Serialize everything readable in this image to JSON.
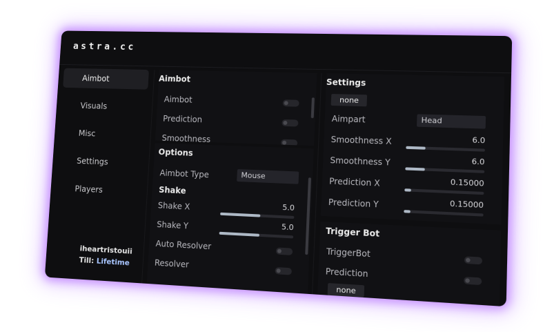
{
  "app": {
    "title": "astra.cc"
  },
  "sidebar": {
    "items": [
      {
        "label": "Aimbot"
      },
      {
        "label": "Visuals"
      },
      {
        "label": "Misc"
      },
      {
        "label": "Settings"
      },
      {
        "label": "Players"
      }
    ],
    "active_index": 0
  },
  "user": {
    "name": "iheartristouii",
    "till_label": "Till:",
    "till_value": "Lifetime"
  },
  "aimbot_panel": {
    "title": "Aimbot",
    "rows": [
      {
        "label": "Aimbot"
      },
      {
        "label": "Prediction"
      },
      {
        "label": "Smoothness"
      }
    ]
  },
  "options_panel": {
    "title": "Options",
    "aimbot_type": {
      "label": "Aimbot Type",
      "value": "Mouse"
    },
    "shake_heading": "Shake",
    "shake_x": {
      "label": "Shake X",
      "value": "5.0",
      "level": 0.55
    },
    "shake_y": {
      "label": "Shake Y",
      "value": "5.0",
      "level": 0.55
    },
    "auto_resolver": {
      "label": "Auto Resolver"
    },
    "resolver": {
      "label": "Resolver"
    }
  },
  "settings_panel": {
    "title": "Settings",
    "keybind": "none",
    "aimpart": {
      "label": "Aimpart",
      "value": "Head"
    },
    "smoothness_x": {
      "label": "Smoothness X",
      "value": "6.0",
      "level": 0.25
    },
    "smoothness_y": {
      "label": "Smoothness Y",
      "value": "6.0",
      "level": 0.25
    },
    "prediction_x": {
      "label": "Prediction X",
      "value": "0.15000",
      "level": 0.08
    },
    "prediction_y": {
      "label": "Prediction Y",
      "value": "0.15000",
      "level": 0.08
    }
  },
  "triggerbot_panel": {
    "title": "Trigger Bot",
    "triggerbot": {
      "label": "TriggerBot"
    },
    "prediction": {
      "label": "Prediction"
    },
    "keybind": "none"
  }
}
